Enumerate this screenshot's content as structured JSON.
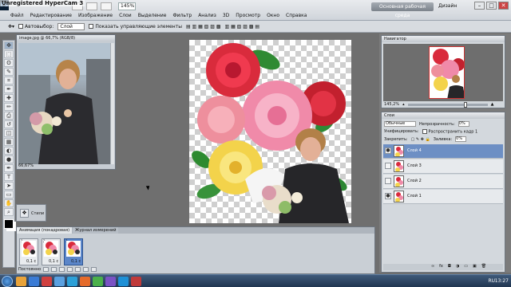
{
  "recorder": {
    "watermark": "Unregistered HyperCam 3"
  },
  "app": {
    "logo": "Ps",
    "zoom": "145%",
    "workspace": "Основная рабочая среда",
    "design": "Дизайн",
    "window_controls": [
      "–",
      "□",
      "✕"
    ]
  },
  "menu": [
    "Файл",
    "Редактирование",
    "Изображение",
    "Слои",
    "Выделение",
    "Фильтр",
    "Анализ",
    "3D",
    "Просмотр",
    "Окно",
    "Справка"
  ],
  "options": {
    "autoselect_label": "Автовыбор:",
    "autoselect_value": "Слой",
    "show_controls_label": "Показать управляющие элементы"
  },
  "tools": [
    "move-tool",
    "marquee-tool",
    "lasso-tool",
    "quick-select-tool",
    "crop-tool",
    "eyedropper-tool",
    "healing-tool",
    "brush-tool",
    "stamp-tool",
    "history-brush-tool",
    "eraser-tool",
    "gradient-tool",
    "blur-tool",
    "dodge-tool",
    "pen-tool",
    "type-tool",
    "path-select-tool",
    "shape-tool",
    "hand-tool",
    "zoom-tool"
  ],
  "tool_glyphs": [
    "✥",
    "⬚",
    "ʘ",
    "✎",
    "⌗",
    "✒",
    "✚",
    "✏",
    "⎙",
    "↺",
    "◫",
    "▦",
    "◐",
    "●",
    "✒",
    "T",
    "➤",
    "▭",
    "✋",
    "⌕"
  ],
  "image_window": {
    "tab": "image.jpg @ 66,7% (RGB/8)",
    "zoom": "66,67%"
  },
  "styles_panel": {
    "label": "Стили"
  },
  "animation": {
    "tabs": [
      "Анимация (покадровая)",
      "Журнал измерений"
    ],
    "frames": [
      {
        "num": "1",
        "delay": "0,1 с"
      },
      {
        "num": "2",
        "delay": "0,1 с"
      },
      {
        "num": "3",
        "delay": "0,1 с"
      }
    ],
    "loop": "Постоянно"
  },
  "navigator": {
    "tab": "Навигатор",
    "zoom": "145,2%"
  },
  "layers": {
    "tab": "Слои",
    "blend": "Обычные",
    "opacity_label": "Непрозрачность:",
    "opacity": "0%",
    "unify_label": "Унифицировать:",
    "spread_label": "Распространить кадр 1",
    "lock_label": "Закрепить:",
    "fill_label": "Заливка:",
    "fill": "0%",
    "items": [
      {
        "name": "Слой 4",
        "visible": true
      },
      {
        "name": "Слой 3",
        "visible": false
      },
      {
        "name": "Слой 2",
        "visible": false
      },
      {
        "name": "Слой 1",
        "visible": true
      }
    ]
  },
  "taskbar": {
    "lang": "RU",
    "time": "13:27"
  }
}
